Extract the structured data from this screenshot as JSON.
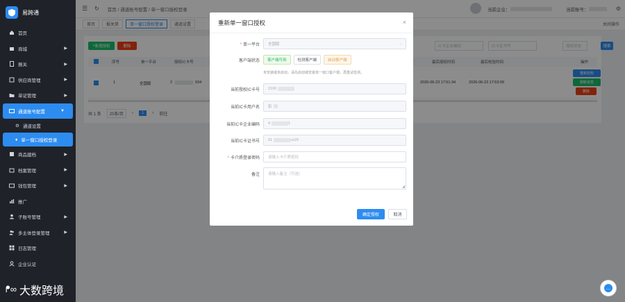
{
  "app": {
    "name": "易跨通",
    "brand": "大数跨境"
  },
  "sidebar": {
    "items": [
      {
        "label": "首页",
        "icon": "home-icon",
        "arrow": false
      },
      {
        "label": "商城",
        "icon": "shop-icon",
        "arrow": true
      },
      {
        "label": "报关",
        "icon": "document-icon",
        "arrow": true
      },
      {
        "label": "供应商管理",
        "icon": "box-icon",
        "arrow": true
      },
      {
        "label": "单证管理",
        "icon": "folder-icon",
        "arrow": true
      },
      {
        "label": "通道账号配置",
        "icon": "link-icon",
        "arrow": true,
        "open": true
      },
      {
        "label": "商品建档",
        "icon": "tag-icon",
        "arrow": true
      },
      {
        "label": "档案管理",
        "icon": "archive-icon",
        "arrow": true
      },
      {
        "label": "钱包管理",
        "icon": "wallet-icon",
        "arrow": true
      },
      {
        "label": "推广",
        "icon": "chart-icon",
        "arrow": false
      },
      {
        "label": "子账号管理",
        "icon": "user-icon",
        "arrow": true
      },
      {
        "label": "多主体登录管理",
        "icon": "users-icon",
        "arrow": true
      },
      {
        "label": "日志管理",
        "icon": "grid-icon",
        "arrow": false
      },
      {
        "label": "企业认证",
        "icon": "person-icon",
        "arrow": false
      }
    ],
    "sub_items": [
      {
        "label": "通道设置",
        "active": false
      },
      {
        "label": "单一窗口授权登录",
        "active": true
      }
    ]
  },
  "topbar": {
    "breadcrumb": [
      "首页",
      "通道账号配置",
      "单一窗口授权登录"
    ],
    "company_label": "当前企业：",
    "account_label": "当前账号："
  },
  "tabs": [
    "首页",
    "报关单",
    "单一窗口授权登录",
    "通道设置"
  ],
  "tabs_extra": "关闭操作",
  "toolbar": {
    "add": "新增授权",
    "delete": "删除",
    "search": "搜索",
    "ic_placeholder": "IC卡企业编码",
    "card_placeholder": "IC卡证书号",
    "status_placeholder": "授权状态"
  },
  "table": {
    "headers": [
      "",
      "序号",
      "单一平台",
      "授权IC卡号",
      "",
      "",
      "",
      "",
      "最后授权时间",
      "最后校验时间",
      "",
      "操作"
    ],
    "row": {
      "index": "1",
      "platform": "全国版",
      "ic": "2",
      "ic_suffix": "934",
      "auth_time": "2026-06-23 17:51:34",
      "check_time": "2026-06-23 17:53:09",
      "actions": [
        "重新授权",
        "刷新状态",
        "删除"
      ]
    }
  },
  "pagination": {
    "total": "共 1 条",
    "per_page": "20条/页",
    "page": "1",
    "goto": "前往"
  },
  "modal": {
    "title": "重新单一窗口授权",
    "close": "×",
    "platform_label": "单一平台",
    "platform_value": "全国版",
    "client_status_label": "客户端状态",
    "status_buttons": [
      "客户端可用",
      "检测客户端",
      "启动客户端"
    ],
    "hint": "未安装或未启动，请先启动或安装单一窗口客户端，再重试检测。",
    "fields": [
      {
        "label": "当前授权IC卡号",
        "value": "2100"
      },
      {
        "label": "当前IC卡用户名",
        "value": "彭"
      },
      {
        "label": "当前IC卡企业编码",
        "value": "4",
        "suffix": "1"
      },
      {
        "label": "当前IC卡证书号",
        "value": "01",
        "suffix": "ce29"
      }
    ],
    "password_label": "卡介质登录密码",
    "password_placeholder": "请输入卡介质密码",
    "remark_label": "备注",
    "remark_placeholder": "请输入备注（可选）",
    "confirm": "确定授权",
    "cancel": "取消"
  },
  "colors": {
    "primary": "#2d8cf0",
    "success": "#19be6b",
    "danger": "#ed4014",
    "sidebar": "#20222a"
  }
}
